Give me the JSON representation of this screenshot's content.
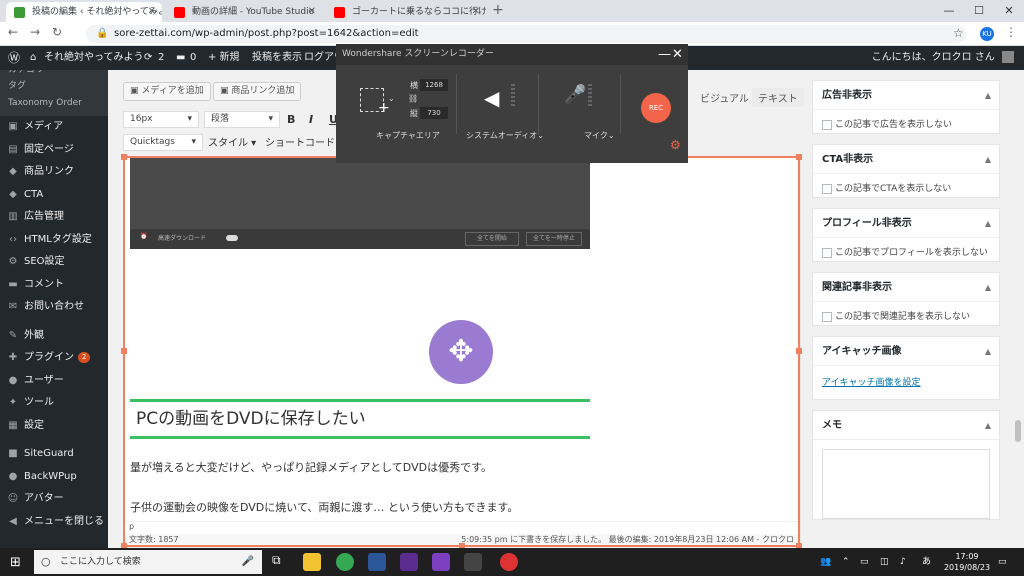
{
  "browser": {
    "tabs": [
      {
        "title": "投稿の編集 ‹ それ絶対やってみよう —",
        "active": true,
        "favicon_color": "#3d9b35"
      },
      {
        "title": "動画の詳細 - YouTube Studio",
        "active": false,
        "favicon_color": "#ff0000"
      },
      {
        "title": "ゴーカートに乗るならココに行け！ワン…",
        "active": false,
        "favicon_color": "#ff0000"
      }
    ],
    "new_tab": "+",
    "url": "sore-zettai.com/wp-admin/post.php?post=1642&action=edit",
    "window_controls": {
      "minimize": "—",
      "maximize": "☐",
      "close": "✕"
    },
    "profile_initial": "KU"
  },
  "adminbar": {
    "site_name": "それ絶対やってみよう",
    "updates": "2",
    "comments": "0",
    "new": "+ 新規",
    "view_post": "投稿を表示",
    "logout": "ログアウ",
    "greeting": "こんにちは、クロクロ さん"
  },
  "sidebar": {
    "sub_items": [
      "カテゴリー",
      "タグ",
      "Taxonomy Order"
    ],
    "items": [
      {
        "icon": "▣",
        "label": "メディア"
      },
      {
        "icon": "▤",
        "label": "固定ページ"
      },
      {
        "icon": "◆",
        "label": "商品リンク"
      },
      {
        "icon": "◆",
        "label": "CTA"
      },
      {
        "icon": "▥",
        "label": "広告管理"
      },
      {
        "icon": "‹›",
        "label": "HTMLタグ設定"
      },
      {
        "icon": "⚙",
        "label": "SEO設定"
      },
      {
        "icon": "▬",
        "label": "コメント"
      },
      {
        "icon": "✉",
        "label": "お問い合わせ"
      },
      {
        "icon": "✎",
        "label": "外観"
      },
      {
        "icon": "✚",
        "label": "プラグイン",
        "badge": "2"
      },
      {
        "icon": "●",
        "label": "ユーザー"
      },
      {
        "icon": "✦",
        "label": "ツール"
      },
      {
        "icon": "▦",
        "label": "設定"
      },
      {
        "icon": "■",
        "label": "SiteGuard"
      },
      {
        "icon": "●",
        "label": "BackWPup"
      },
      {
        "icon": "☺",
        "label": "アバター"
      },
      {
        "icon": "◀",
        "label": "メニューを閉じる"
      }
    ]
  },
  "editor": {
    "add_media": "メディアを追加",
    "product_link": "商品リンク追加",
    "tab_visual": "ビジュアル",
    "tab_text": "テキスト",
    "font_size": "16px",
    "format": "段落",
    "quicktags": "Quicktags",
    "style": "スタイル",
    "shortcode": "ショートコード",
    "tool_bold": "B",
    "tool_italic": "I",
    "tool_underline": "U",
    "image_caption_left": "高速ダウンロード",
    "image_btn1": "全てを開始",
    "image_btn2": "全てを一時停止",
    "heading": "PCの動画をDVDに保存したい",
    "para1": "量が増えると大変だけど、やっぱり記録メディアとしてDVDは優秀です。",
    "para2": "子供の運動会の映像をDVDに焼いて、両親に渡す… という使い方もできます。",
    "path": "p",
    "word_count": "文字数: 1857",
    "autosave": "5:09:35 pm に下書きを保存しました。 最後の編集: 2019年8月23日 12:06 AM - クロクロ"
  },
  "recorder": {
    "title": "Wondershare スクリーンレコーダー",
    "width_label": "横",
    "width_value": "1268",
    "height_label": "縦",
    "height_value": "730",
    "capture_area": "キャプチャエリア",
    "system_audio": "システムオーディオ",
    "mic": "マイク",
    "rec": "REC",
    "minimize": "—",
    "close": "✕"
  },
  "metaboxes": [
    {
      "title": "広告非表示",
      "body": "この記事で広告を表示しない",
      "type": "checkbox"
    },
    {
      "title": "CTA非表示",
      "body": "この記事でCTAを表示しない",
      "type": "checkbox"
    },
    {
      "title": "プロフィール非表示",
      "body": "この記事でプロフィールを表示しない",
      "type": "checkbox"
    },
    {
      "title": "関連記事非表示",
      "body": "この記事で関連記事を表示しない",
      "type": "checkbox"
    },
    {
      "title": "アイキャッチ画像",
      "body": "アイキャッチ画像を設定",
      "type": "link"
    },
    {
      "title": "メモ",
      "body": "",
      "type": "textarea"
    }
  ],
  "taskbar": {
    "search_placeholder": "ここに入力して検索",
    "time": "17:09",
    "date": "2019/08/23",
    "ime": "あ"
  }
}
